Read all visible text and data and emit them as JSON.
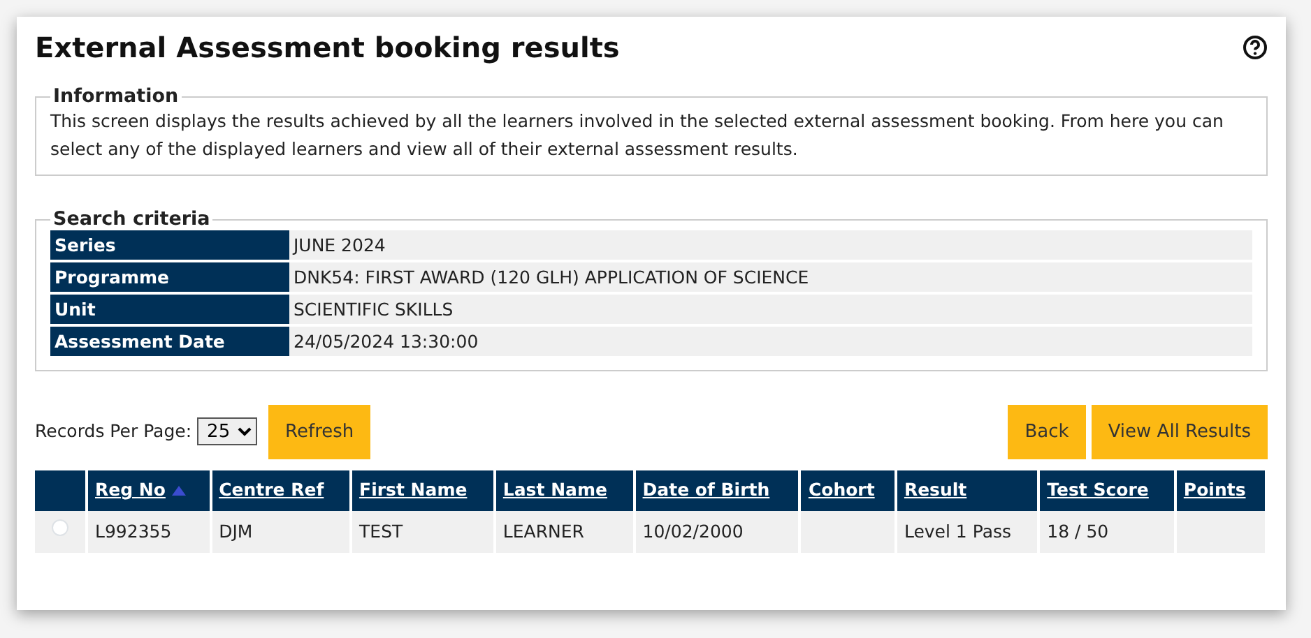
{
  "page": {
    "title": "External Assessment booking results"
  },
  "information": {
    "legend": "Information",
    "text": "This screen displays the results achieved by all the learners involved in the selected external assessment booking. From here you can select any of the displayed learners and view all of their external assessment results."
  },
  "search_criteria": {
    "legend": "Search criteria",
    "rows": [
      {
        "label": "Series",
        "value": "JUNE 2024"
      },
      {
        "label": "Programme",
        "value": "DNK54: FIRST AWARD (120 GLH) APPLICATION OF SCIENCE"
      },
      {
        "label": "Unit",
        "value": "SCIENTIFIC SKILLS"
      },
      {
        "label": "Assessment Date",
        "value": "24/05/2024 13:30:00"
      }
    ]
  },
  "toolbar": {
    "records_label": "Records Per Page:",
    "records_value": "25",
    "refresh": "Refresh",
    "buttons": [
      "Back",
      "View All Results"
    ]
  },
  "table": {
    "columns": [
      {
        "label": "Reg No",
        "sorted": true
      },
      {
        "label": "Centre Ref",
        "sorted": false
      },
      {
        "label": "First Name",
        "sorted": false
      },
      {
        "label": "Last Name",
        "sorted": false
      },
      {
        "label": "Date of Birth",
        "sorted": false
      },
      {
        "label": "Cohort",
        "sorted": false
      },
      {
        "label": "Result",
        "sorted": false
      },
      {
        "label": "Test Score",
        "sorted": false
      },
      {
        "label": "Points",
        "sorted": false
      }
    ],
    "rows": [
      {
        "selected": false,
        "cells": [
          "L992355",
          "DJM",
          "TEST",
          "LEARNER",
          "10/02/2000",
          "",
          "Level 1 Pass",
          "18 / 50",
          ""
        ]
      }
    ]
  }
}
